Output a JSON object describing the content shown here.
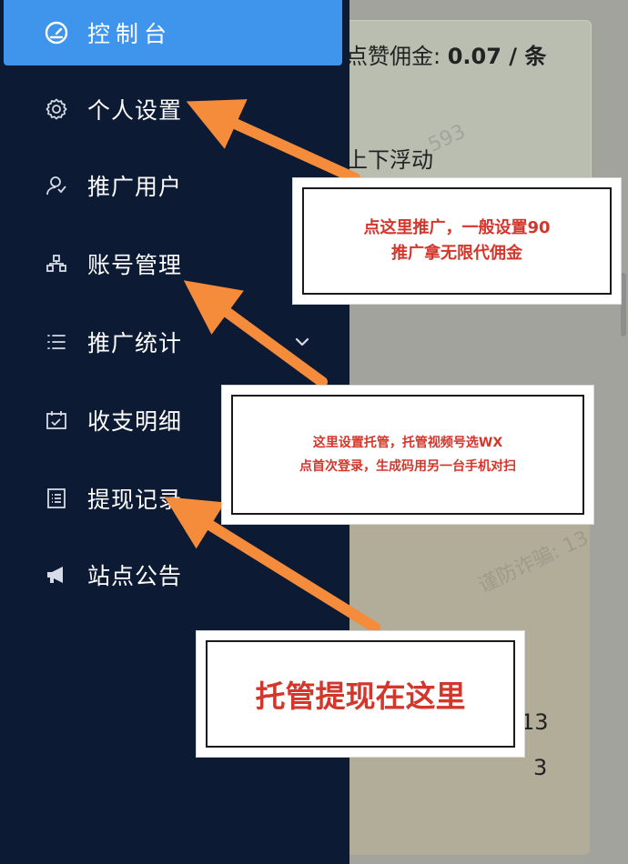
{
  "sidebar": {
    "items": [
      {
        "label": "控制台",
        "icon": "dashboard-icon"
      },
      {
        "label": "个人设置",
        "icon": "gear-icon"
      },
      {
        "label": "推广用户",
        "icon": "users-icon"
      },
      {
        "label": "账号管理",
        "icon": "sitemap-icon"
      },
      {
        "label": "推广统计",
        "icon": "list-icon",
        "expandable": true
      },
      {
        "label": "收支明细",
        "icon": "calendar-icon"
      },
      {
        "label": "提现记录",
        "icon": "document-icon"
      },
      {
        "label": "站点公告",
        "icon": "megaphone-icon"
      }
    ],
    "active_index": 0,
    "expand_icon": "chevron-down-icon"
  },
  "background": {
    "commission_label": "点赞佣金:",
    "commission_value": "0.07 / 条",
    "float_text": "上下浮动",
    "number_1": "13",
    "number_2": "3",
    "watermark_1": "593",
    "watermark_2": "谨防诈骗: 13"
  },
  "annotations": {
    "note_1": {
      "line1": "点这里推广，一般设置90",
      "line2": "推广拿无限代佣金"
    },
    "note_2": {
      "line1": "这里设置托管，托管视频号选WX",
      "line2": "点首次登录，生成码用另一台手机对扫"
    },
    "note_3": {
      "text": "托管提现在这里"
    },
    "arrow_color": "#f58c3c",
    "note_text_color": "#d3362b"
  },
  "colors": {
    "sidebar_bg": "#0d1a33",
    "active_bg": "#3f95ec"
  }
}
